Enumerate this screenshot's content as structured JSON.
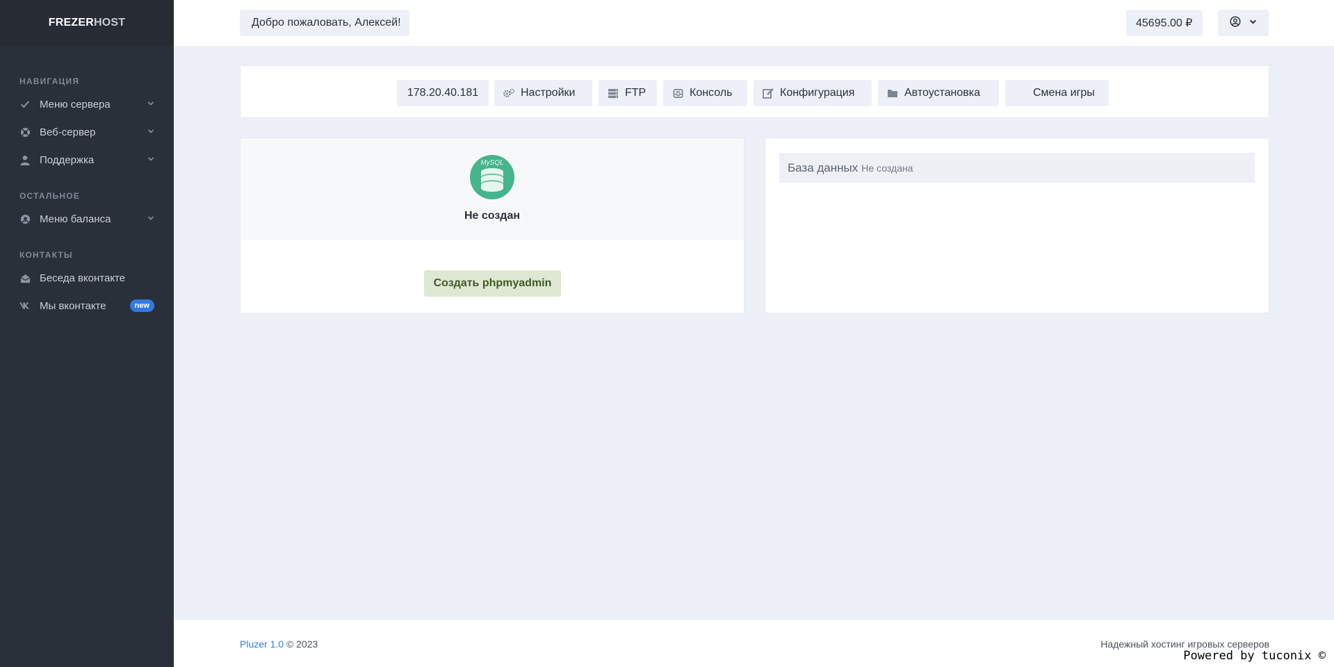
{
  "sidebar": {
    "brand_part1": "FREZER",
    "brand_part2": "HOST",
    "sections": [
      {
        "heading": "НАВИГАЦИЯ"
      },
      {
        "heading": "ОСТАЛЬНОЕ"
      },
      {
        "heading": "КОНТАКТЫ"
      }
    ],
    "items": [
      {
        "label": "Меню сервера",
        "icon": "check-icon"
      },
      {
        "label": "Веб-сервер",
        "icon": "lifebuoy-icon"
      },
      {
        "label": "Поддержка",
        "icon": "user-icon"
      },
      {
        "label": "Меню баланса",
        "icon": "wallet-icon"
      },
      {
        "label": "Беседа вконтакте",
        "icon": "envelope-open-icon"
      },
      {
        "label": "Мы вконтакте",
        "icon": "vk-icon",
        "badge": "new"
      }
    ]
  },
  "header": {
    "welcome": "Добро пожаловать, Алексей!",
    "balance": "45695.00 ₽"
  },
  "tabs": [
    {
      "label": "178.20.40.181",
      "icon": ""
    },
    {
      "label": "Настройки",
      "icon": "gears-icon"
    },
    {
      "label": "FTP",
      "icon": "server-icon"
    },
    {
      "label": "Консоль",
      "icon": "inbox-icon"
    },
    {
      "label": "Конфигурация",
      "icon": "edit-icon"
    },
    {
      "label": "Автоустановка",
      "icon": "folder-icon"
    },
    {
      "label": "Смена игры",
      "icon": ""
    }
  ],
  "mysql_card": {
    "logo_text": "MySQL",
    "status": "Не создан",
    "create_button": "Создать phpmyadmin"
  },
  "db_card": {
    "label": "База данных",
    "value": "Не создана"
  },
  "footer": {
    "brand": "Pluzer 1.0",
    "copyright": "© 2023",
    "tagline": "Надежный хостинг игровых серверов",
    "powered": "Powered by tuconix ©"
  },
  "colors": {
    "sidebar_bg": "#2a303a",
    "page_bg": "#edf0f7",
    "accent_blue": "#2f7ae5",
    "success_green": "#46b48c",
    "button_green_bg": "#dfe8d2"
  }
}
